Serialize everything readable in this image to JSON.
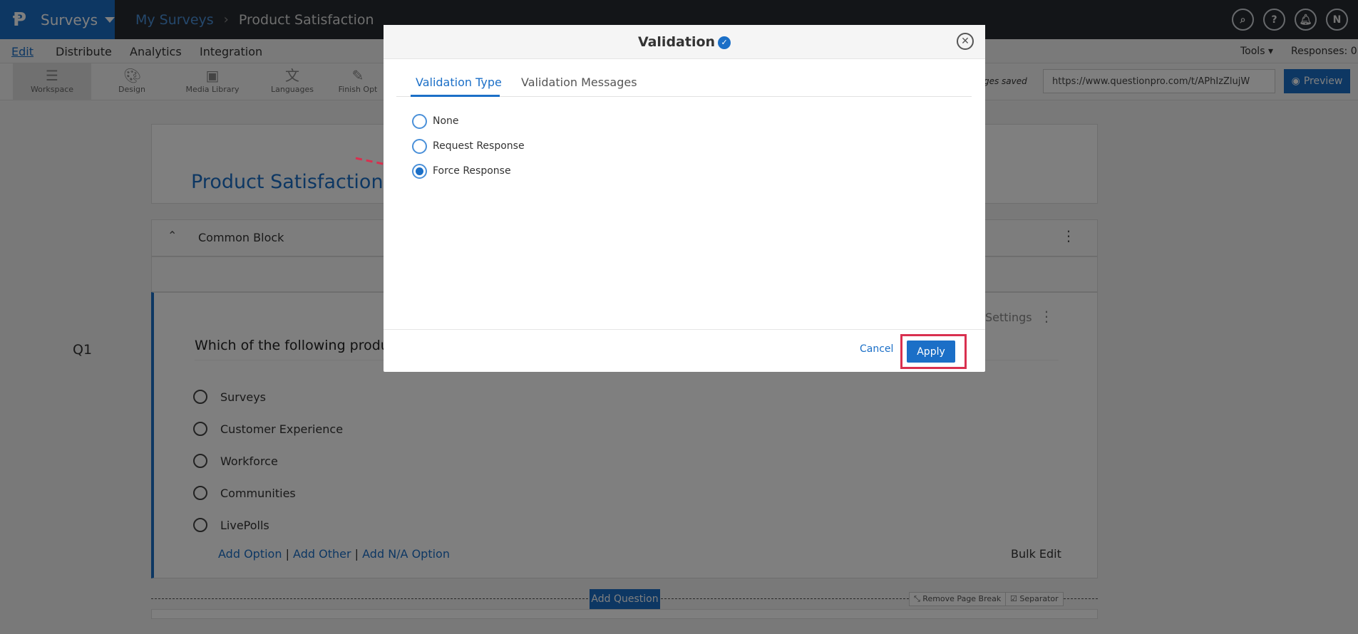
{
  "app": {
    "brand": "Surveys",
    "breadcrumb": [
      "My Surveys",
      "Product Satisfaction"
    ],
    "top_icons": [
      "search-icon",
      "help-icon",
      "bell-icon",
      "user-avatar"
    ],
    "avatar_initial": "N"
  },
  "menu": {
    "items": [
      "Edit",
      "Distribute",
      "Analytics",
      "Integration"
    ],
    "active": "Edit",
    "tools": "Tools",
    "responses": "Responses: 0"
  },
  "toolbar": {
    "items": [
      "Workspace",
      "Design",
      "Media Library",
      "Languages",
      "Finish Opt"
    ],
    "changes": "anges saved",
    "url": "https://www.questionpro.com/t/APhIzZlujW",
    "preview": "Preview"
  },
  "survey": {
    "title": "Product Satisfaction",
    "block": "Common Block",
    "question_number": "Q1",
    "question_text": "Which of the following produ",
    "settings_label": "Settings",
    "options": [
      "Surveys",
      "Customer Experience",
      "Workforce",
      "Communities",
      "LivePolls"
    ],
    "add_links": [
      "Add Option",
      "Add Other",
      "Add N/A Option"
    ],
    "bulk_edit": "Bulk Edit",
    "add_question": "Add Question",
    "remove_page_break": "Remove Page Break",
    "separator": "Separator"
  },
  "modal": {
    "title": "Validation",
    "tabs": [
      "Validation Type",
      "Validation Messages"
    ],
    "active_tab": "Validation Type",
    "options": [
      "None",
      "Request Response",
      "Force Response"
    ],
    "selected": "Force Response",
    "cancel": "Cancel",
    "apply": "Apply",
    "highlight_color": "#d9304f",
    "accent_color": "#1b6fc7"
  }
}
